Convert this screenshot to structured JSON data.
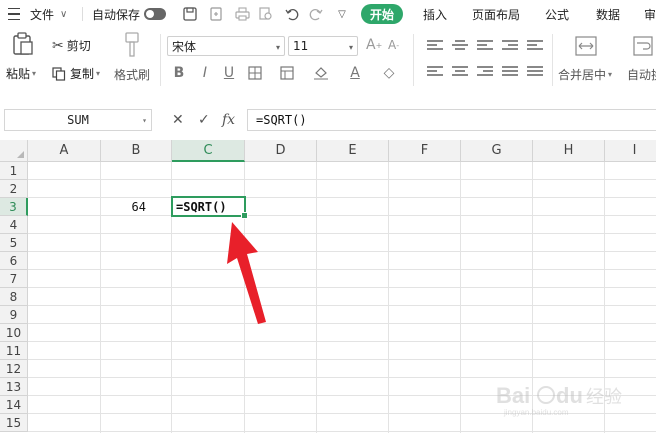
{
  "menubar": {
    "file_label": "文件",
    "autosave_label": "自动保存",
    "tabs": [
      {
        "label": "开始",
        "active": true
      },
      {
        "label": "插入"
      },
      {
        "label": "页面布局"
      },
      {
        "label": "公式"
      },
      {
        "label": "数据"
      },
      {
        "label": "审"
      }
    ]
  },
  "ribbon": {
    "paste_label": "粘贴",
    "cut_label": "剪切",
    "copy_label": "复制",
    "format_painter_label": "格式刷",
    "font_name": "宋体",
    "font_size": "11",
    "merge_center_label": "合并居中",
    "auto_wrap_label": "自动换"
  },
  "formula_bar": {
    "name_box": "SUM",
    "cancel_icon": "✕",
    "confirm_icon": "✓",
    "fx_label": "fx",
    "formula": "=SQRT()"
  },
  "sheet": {
    "columns": [
      "A",
      "B",
      "C",
      "D",
      "E",
      "F",
      "G",
      "H",
      "I"
    ],
    "rows": [
      "1",
      "2",
      "3",
      "4",
      "5",
      "6",
      "7",
      "8",
      "9",
      "10",
      "11",
      "12",
      "13",
      "14",
      "15"
    ],
    "selected_column": "C",
    "selected_row": "3",
    "cell_b3": "64",
    "cell_c3_editing": "=SQRT()"
  },
  "colors": {
    "accent": "#2ea76a",
    "selection": "#2e9c5e",
    "arrow": "#e8202a"
  }
}
